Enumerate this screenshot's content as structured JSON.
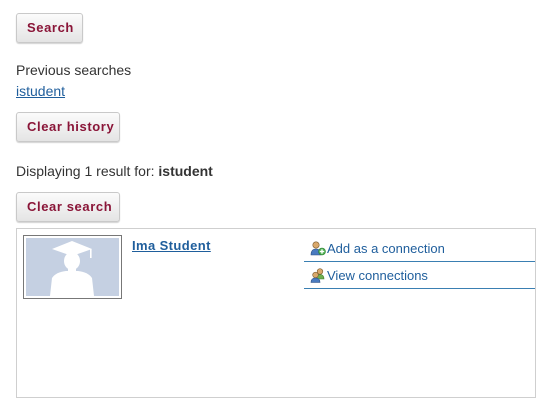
{
  "buttons": {
    "search": "Search",
    "clear_history": "Clear history",
    "clear_search": "Clear search"
  },
  "previous_searches": {
    "label": "Previous searches",
    "items": [
      "istudent"
    ]
  },
  "results_summary": {
    "prefix": "Displaying 1 result for:",
    "query": "istudent"
  },
  "results": [
    {
      "name": "Ima Student",
      "avatar": "graduate-silhouette-icon",
      "actions": [
        {
          "label": "Add as a connection",
          "icon": "add-connection-icon"
        },
        {
          "label": "View connections",
          "icon": "view-connections-icon"
        }
      ]
    }
  ],
  "colors": {
    "button_text": "#8a1538",
    "link": "#1f5e9c",
    "divider": "#3a7fb2",
    "avatar_bg": "#c5d0e2"
  }
}
